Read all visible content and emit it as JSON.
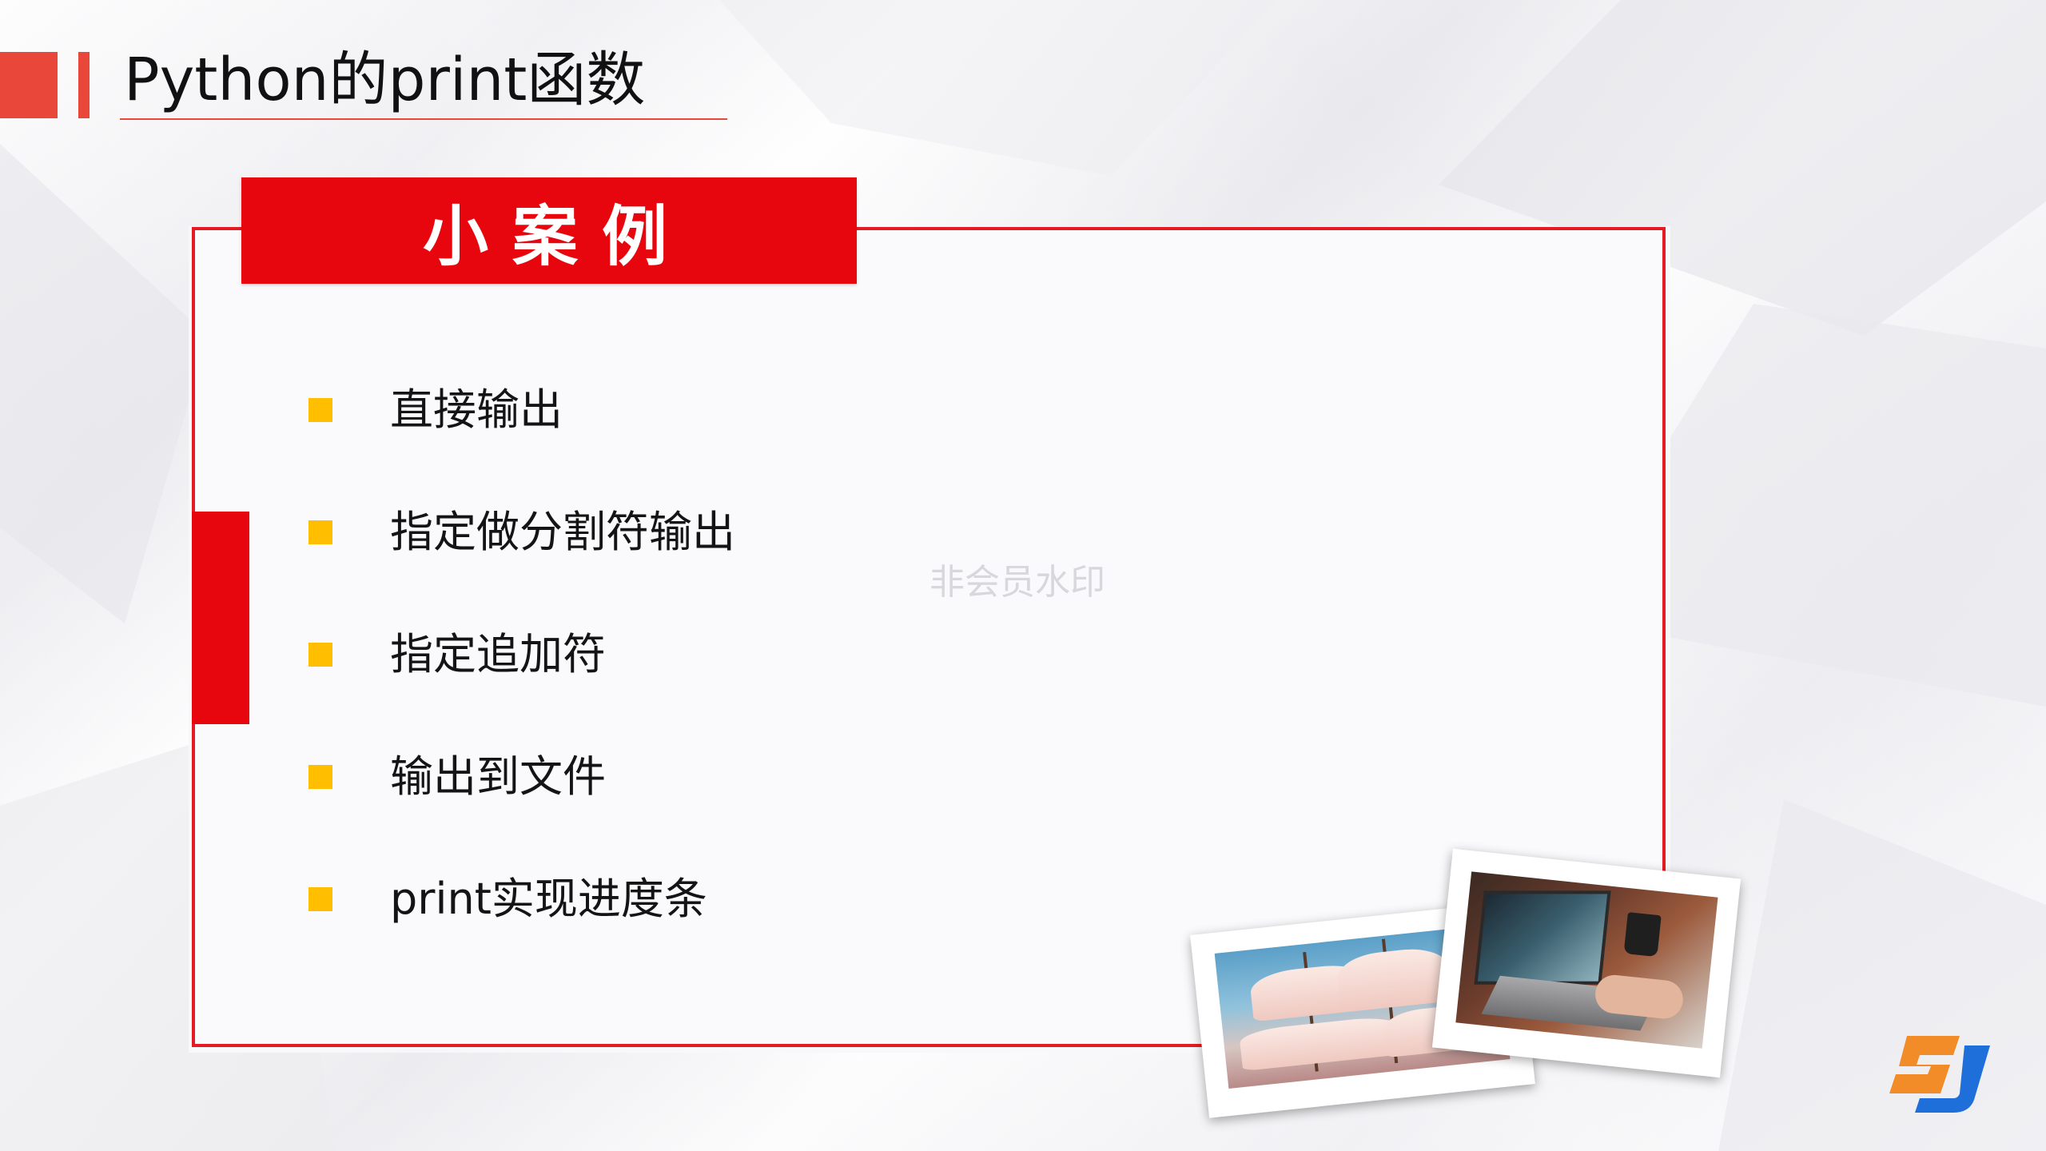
{
  "header": {
    "title": "Python的print函数"
  },
  "card": {
    "tab_label": "小案例",
    "items": [
      {
        "label": "直接输出"
      },
      {
        "label": "指定做分割符输出"
      },
      {
        "label": "指定追加符"
      },
      {
        "label": "输出到文件"
      },
      {
        "label": "print实现进度条"
      }
    ]
  },
  "watermark": "非会员水印",
  "colors": {
    "accent_red": "#e8060e",
    "header_red": "#e8473a",
    "bullet_yellow": "#ffbf00",
    "logo_orange": "#f28c28",
    "logo_blue": "#1e6fd9"
  },
  "icons": {
    "logo": "sj-brand-logo-icon",
    "bullet": "square-bullet-icon"
  }
}
